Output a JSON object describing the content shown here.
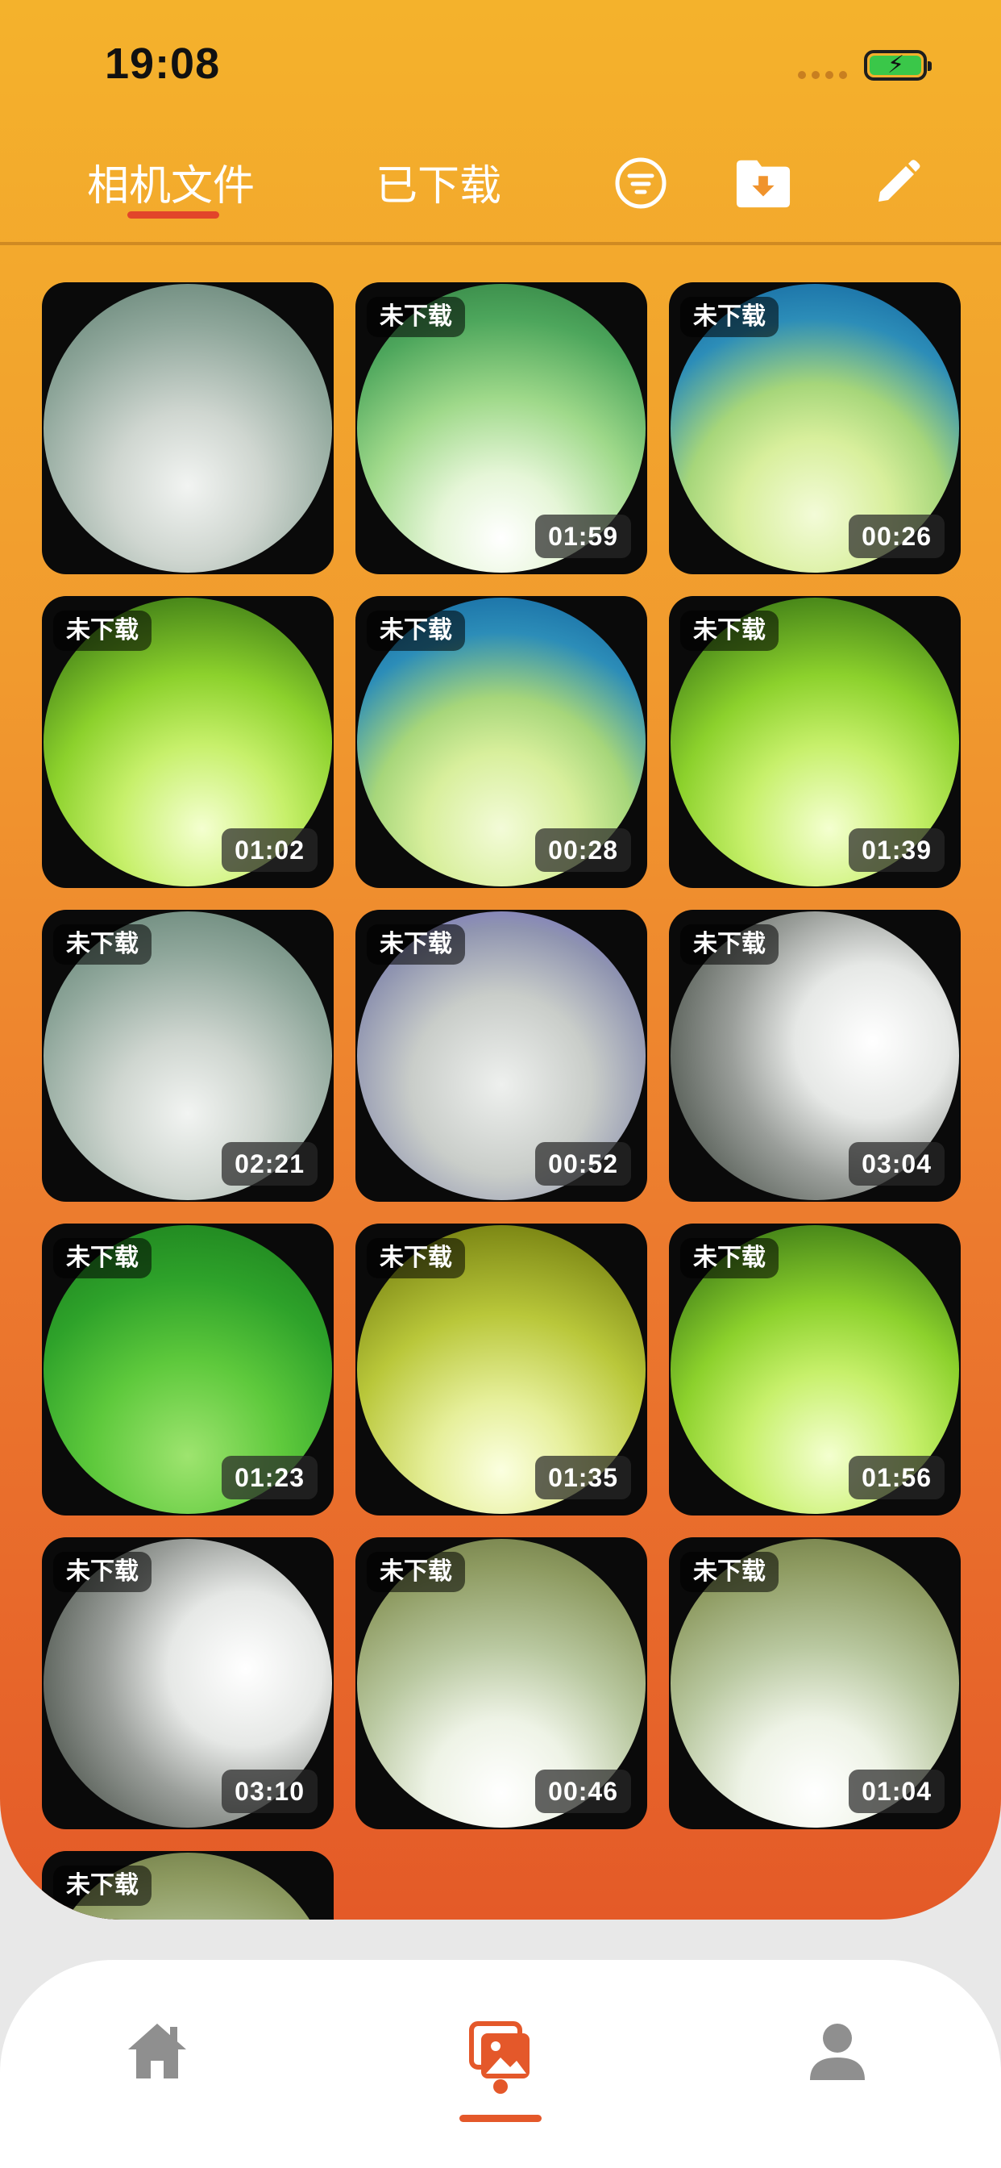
{
  "status_bar": {
    "time": "19:08"
  },
  "header": {
    "tabs": [
      {
        "label": "相机文件",
        "active": true
      },
      {
        "label": "已下载",
        "active": false
      }
    ],
    "actions": [
      "filter-icon",
      "download-folder-icon",
      "edit-pencil-icon"
    ]
  },
  "colors": {
    "accent": "#e4582a",
    "header_top": "#f4b22c",
    "header_bottom": "#e45a28"
  },
  "files": [
    {
      "badge": "",
      "duration": "",
      "scene": "fish-grey"
    },
    {
      "badge": "未下载",
      "duration": "01:59",
      "scene": "green-bright"
    },
    {
      "badge": "未下载",
      "duration": "00:26",
      "scene": "blue-green"
    },
    {
      "badge": "未下载",
      "duration": "01:02",
      "scene": "lime"
    },
    {
      "badge": "未下载",
      "duration": "00:28",
      "scene": "blue-green"
    },
    {
      "badge": "未下载",
      "duration": "01:39",
      "scene": "lime"
    },
    {
      "badge": "未下载",
      "duration": "02:21",
      "scene": "fish-grey"
    },
    {
      "badge": "未下载",
      "duration": "00:52",
      "scene": "fish-purple"
    },
    {
      "badge": "未下载",
      "duration": "03:04",
      "scene": "shore"
    },
    {
      "badge": "未下载",
      "duration": "01:23",
      "scene": "green-deep"
    },
    {
      "badge": "未下载",
      "duration": "01:35",
      "scene": "yellow-green"
    },
    {
      "badge": "未下载",
      "duration": "01:56",
      "scene": "lime"
    },
    {
      "badge": "未下载",
      "duration": "03:10",
      "scene": "shore"
    },
    {
      "badge": "未下载",
      "duration": "00:46",
      "scene": "murky"
    },
    {
      "badge": "未下载",
      "duration": "01:04",
      "scene": "murky"
    },
    {
      "badge": "未下载",
      "duration": "",
      "scene": "murky"
    }
  ],
  "bottom_nav": [
    {
      "icon": "home-icon",
      "active": false
    },
    {
      "icon": "gallery-icon",
      "active": true
    },
    {
      "icon": "user-icon",
      "active": false
    }
  ]
}
